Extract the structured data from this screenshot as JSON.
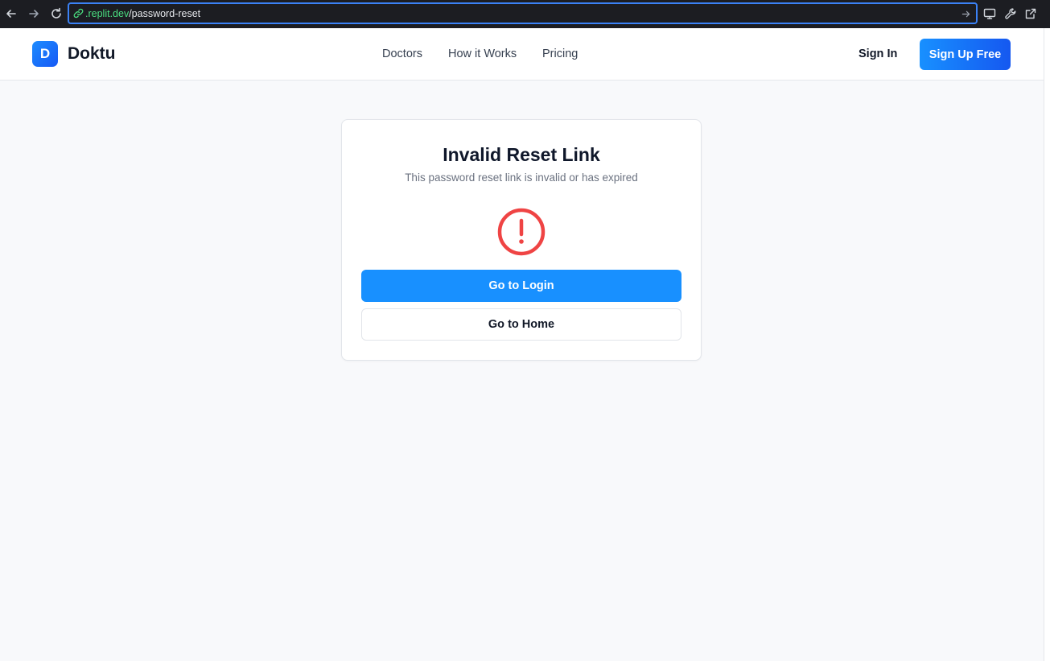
{
  "browser": {
    "url_domain": ".replit.dev",
    "url_path": "/password-reset"
  },
  "header": {
    "logo_letter": "D",
    "brand": "Doktu",
    "nav": [
      "Doctors",
      "How it Works",
      "Pricing"
    ],
    "sign_in": "Sign In",
    "sign_up": "Sign Up Free"
  },
  "card": {
    "title": "Invalid Reset Link",
    "subtitle": "This password reset link is invalid or has expired",
    "primary_button": "Go to Login",
    "secondary_button": "Go to Home"
  },
  "colors": {
    "accent": "#1890ff",
    "error": "#ef4444",
    "url_domain": "#4ade80",
    "url_focus": "#3b82f6"
  },
  "icons": {
    "back": "arrow-left-icon",
    "forward": "arrow-right-icon",
    "reload": "reload-icon",
    "link": "link-icon",
    "go": "arrow-right-icon",
    "device": "monitor-icon",
    "devtools": "wrench-icon",
    "open_external": "external-link-icon",
    "alert": "alert-circle-icon"
  }
}
